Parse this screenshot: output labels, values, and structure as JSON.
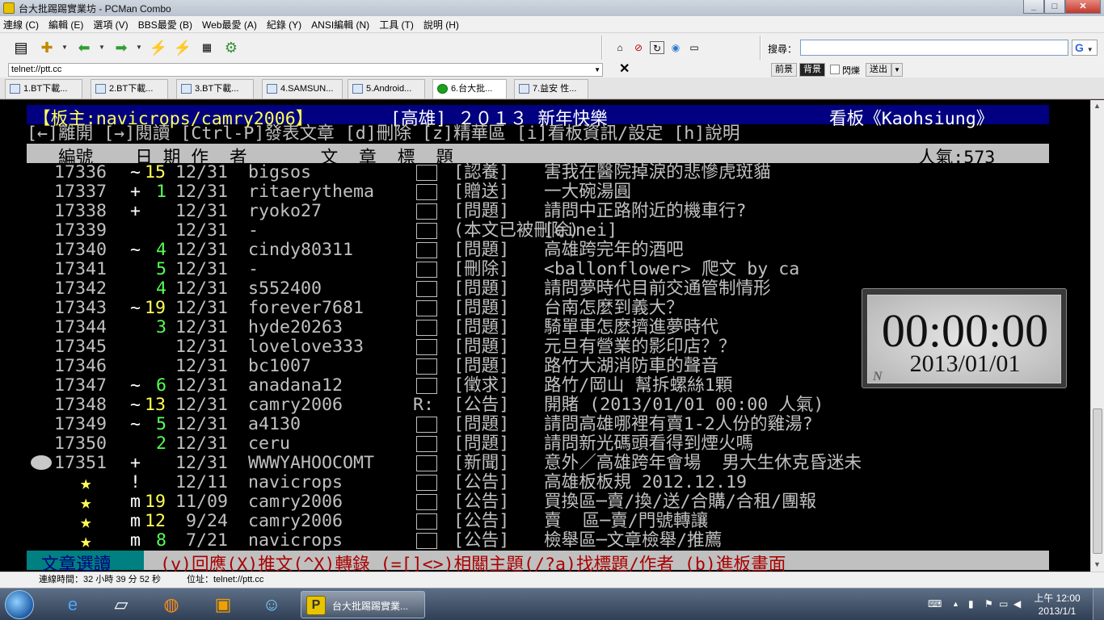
{
  "window": {
    "title": "台大批踢踢實業坊 - PCMan Combo",
    "minimize": "_",
    "maximize": "□",
    "close": "✕"
  },
  "menu": [
    "連線 (C)",
    "編輯 (E)",
    "選項 (V)",
    "BBS最愛 (B)",
    "Web最愛 (A)",
    "紀錄 (Y)",
    "ANSI編輯 (N)",
    "工具 (T)",
    "說明 (H)"
  ],
  "toolbar": {
    "icons": [
      "site-list-icon",
      "new-connection-icon",
      "back-arrow-icon",
      "forward-arrow-icon",
      "disconnect-icon",
      "reconnect-icon",
      "ansi-icon",
      "settings-gear-icon",
      "home-icon",
      "stop-icon",
      "refresh-icon",
      "web-icon",
      "bbs-icon"
    ],
    "search_label": "搜尋：",
    "search_value": "",
    "search_engine": "G"
  },
  "address": {
    "value": "telnet://ptt.cc",
    "close": "✕",
    "fg_button": "前景",
    "bg_button": "背景",
    "blink_label": "閃爍",
    "send_button": "送出"
  },
  "tabs": [
    {
      "label": "1.BT下載..."
    },
    {
      "label": "2.BT下載..."
    },
    {
      "label": "3.BT下載..."
    },
    {
      "label": "4.SAMSUN..."
    },
    {
      "label": "5.Android..."
    },
    {
      "label": "6.台大批..."
    },
    {
      "label": "7.益安 性..."
    }
  ],
  "terminal": {
    "header_left": "【板主:navicrops/camry2006】",
    "header_city": "[高雄]",
    "header_msg": " ２０１３ 新年快樂",
    "header_board": "看板《Kaohsiung》",
    "help_line": "[←]離開 [→]閱讀 [Ctrl-P]發表文章 [d]刪除 [z]精華區 [i]看板資訊/設定 [h]說明",
    "col_header": "   編號    日 期 作  者       文  章  標  題",
    "popularity": "人氣:573",
    "posts": [
      {
        "num": "17336",
        "mark": "~",
        "score": "15",
        "date": "12/31",
        "author": "bigsos",
        "flag": "",
        "tag": "[認養]",
        "title": "害我在醫院掉淚的悲慘虎斑貓"
      },
      {
        "num": "17337",
        "mark": "+",
        "score": "1",
        "date": "12/31",
        "author": "ritaerythema",
        "flag": "",
        "tag": "[贈送]",
        "title": "一大碗湯圓"
      },
      {
        "num": "17338",
        "mark": "+",
        "score": "",
        "date": "12/31",
        "author": "ryoko27",
        "flag": "",
        "tag": "[問題]",
        "title": "請問中正路附近的機車行?"
      },
      {
        "num": "17339",
        "mark": "",
        "score": "",
        "date": "12/31",
        "author": "-",
        "flag": "",
        "tag": "(本文已被刪除)",
        "title": "[einei]"
      },
      {
        "num": "17340",
        "mark": "~",
        "score": "4",
        "date": "12/31",
        "author": "cindy80311",
        "flag": "",
        "tag": "[問題]",
        "title": "高雄跨完年的酒吧"
      },
      {
        "num": "17341",
        "mark": "",
        "score": "5",
        "date": "12/31",
        "author": "-",
        "flag": "",
        "tag": "[刪除]",
        "title": "<ballonflower> 爬文 by ca"
      },
      {
        "num": "17342",
        "mark": "",
        "score": "4",
        "date": "12/31",
        "author": "s552400",
        "flag": "",
        "tag": "[問題]",
        "title": "請問夢時代目前交通管制情形"
      },
      {
        "num": "17343",
        "mark": "~",
        "score": "19",
        "date": "12/31",
        "author": "forever7681",
        "flag": "",
        "tag": "[問題]",
        "title": "台南怎麼到義大？"
      },
      {
        "num": "17344",
        "mark": "",
        "score": "3",
        "date": "12/31",
        "author": "hyde20263",
        "flag": "",
        "tag": "[問題]",
        "title": "騎單車怎麼擠進夢時代"
      },
      {
        "num": "17345",
        "mark": "",
        "score": "",
        "date": "12/31",
        "author": "lovelove333",
        "flag": "",
        "tag": "[問題]",
        "title": "元旦有營業的影印店？？"
      },
      {
        "num": "17346",
        "mark": "",
        "score": "",
        "date": "12/31",
        "author": "bc1007",
        "flag": "",
        "tag": "[問題]",
        "title": "路竹大湖消防車的聲音"
      },
      {
        "num": "17347",
        "mark": "~",
        "score": "6",
        "date": "12/31",
        "author": "anadana12",
        "flag": "",
        "tag": "[徵求]",
        "title": "路竹/岡山 幫拆螺絲1顆"
      },
      {
        "num": "17348",
        "mark": "~",
        "score": "13",
        "date": "12/31",
        "author": "camry2006",
        "flag": "R:",
        "tag": "[公告]",
        "title": "開賭 (2013/01/01 00:00 人氣)"
      },
      {
        "num": "17349",
        "mark": "~",
        "score": "5",
        "date": "12/31",
        "author": "a4130",
        "flag": "",
        "tag": "[問題]",
        "title": "請問高雄哪裡有賣1-2人份的雞湯?"
      },
      {
        "num": "17350",
        "mark": "",
        "score": "2",
        "date": "12/31",
        "author": "ceru",
        "flag": "",
        "tag": "[問題]",
        "title": "請問新光碼頭看得到煙火嗎"
      },
      {
        "num": "17351",
        "mark": "+",
        "score": "",
        "date": "12/31",
        "author": "WWWYAHOOCOMT",
        "flag": "",
        "tag": "[新聞]",
        "title": "意外／高雄跨年會場  男大生休克昏迷未"
      },
      {
        "num": "★",
        "mark": "!",
        "score": "",
        "date": "12/11",
        "author": "navicrops",
        "flag": "",
        "tag": "[公告]",
        "title": "高雄板板規 2012.12.19"
      },
      {
        "num": "★",
        "mark": "m",
        "score": "19",
        "date": "11/09",
        "author": "camry2006",
        "flag": "",
        "tag": "[公告]",
        "title": "買換區─賣/換/送/合購/合租/團報"
      },
      {
        "num": "★",
        "mark": "m",
        "score": "12",
        "date": " 9/24",
        "author": "camry2006",
        "flag": "",
        "tag": "[公告]",
        "title": "賣  區─賣/門號轉讓"
      },
      {
        "num": "★",
        "mark": "m",
        "score": "8",
        "date": " 7/21",
        "author": "navicrops",
        "flag": "",
        "tag": "[公告]",
        "title": "檢舉區─文章檢舉/推薦"
      }
    ],
    "footer_mode": "文章選讀",
    "footer_help": "(y)回應(X)推文(^X)轉錄 (=[]<>)相關主題(/?a)找標題/作者 (b)進板畫面"
  },
  "clock_widget": {
    "time": "00:00:00",
    "date": "2013/01/01",
    "mark": "N"
  },
  "status": {
    "time_label": "連線時間：32 小時 39 分 52 秒",
    "addr_label": "位址：telnet://ptt.cc"
  },
  "taskbar": {
    "active_label": "台大批踢踢實業...",
    "clock_time": "上午 12:00",
    "clock_date": "2013/1/1"
  }
}
